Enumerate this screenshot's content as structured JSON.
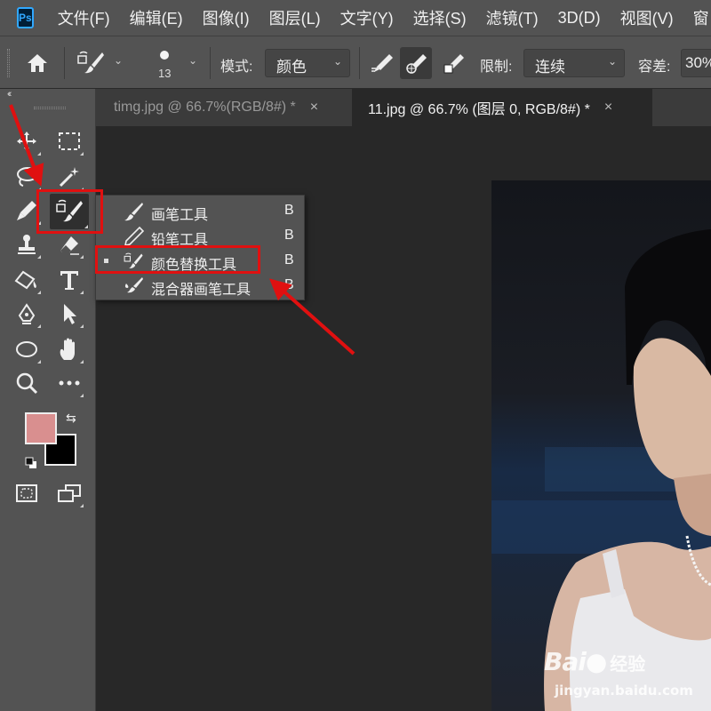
{
  "app": {
    "logo": "Ps"
  },
  "menu": [
    "文件(F)",
    "编辑(E)",
    "图像(I)",
    "图层(L)",
    "文字(Y)",
    "选择(S)",
    "滤镜(T)",
    "3D(D)",
    "视图(V)",
    "窗"
  ],
  "options": {
    "brush_size": "13",
    "mode_label": "模式:",
    "mode_value": "颜色",
    "limit_label": "限制:",
    "limit_value": "连续",
    "tolerance_label": "容差:",
    "tolerance_value": "30%"
  },
  "tabs": [
    {
      "label": "timg.jpg @ 66.7%(RGB/8#) *",
      "close": "×"
    },
    {
      "label": "11.jpg @ 66.7% (图层 0, RGB/8#) *",
      "close": "×"
    }
  ],
  "toolbar": {
    "collapse": "‹‹"
  },
  "colors": {
    "foreground": "#d98f8f",
    "background": "#000000",
    "accent": "#e01010",
    "ps_blue": "#31a8ff"
  },
  "flyout": {
    "items": [
      {
        "label": "画笔工具",
        "key": "B"
      },
      {
        "label": "铅笔工具",
        "key": "B"
      },
      {
        "label": "颜色替换工具",
        "key": "B"
      },
      {
        "label": "混合器画笔工具",
        "key": "B"
      }
    ]
  },
  "watermark": {
    "brand": "Bai",
    "brand2": "经验",
    "url": "jingyan.baidu.com"
  }
}
